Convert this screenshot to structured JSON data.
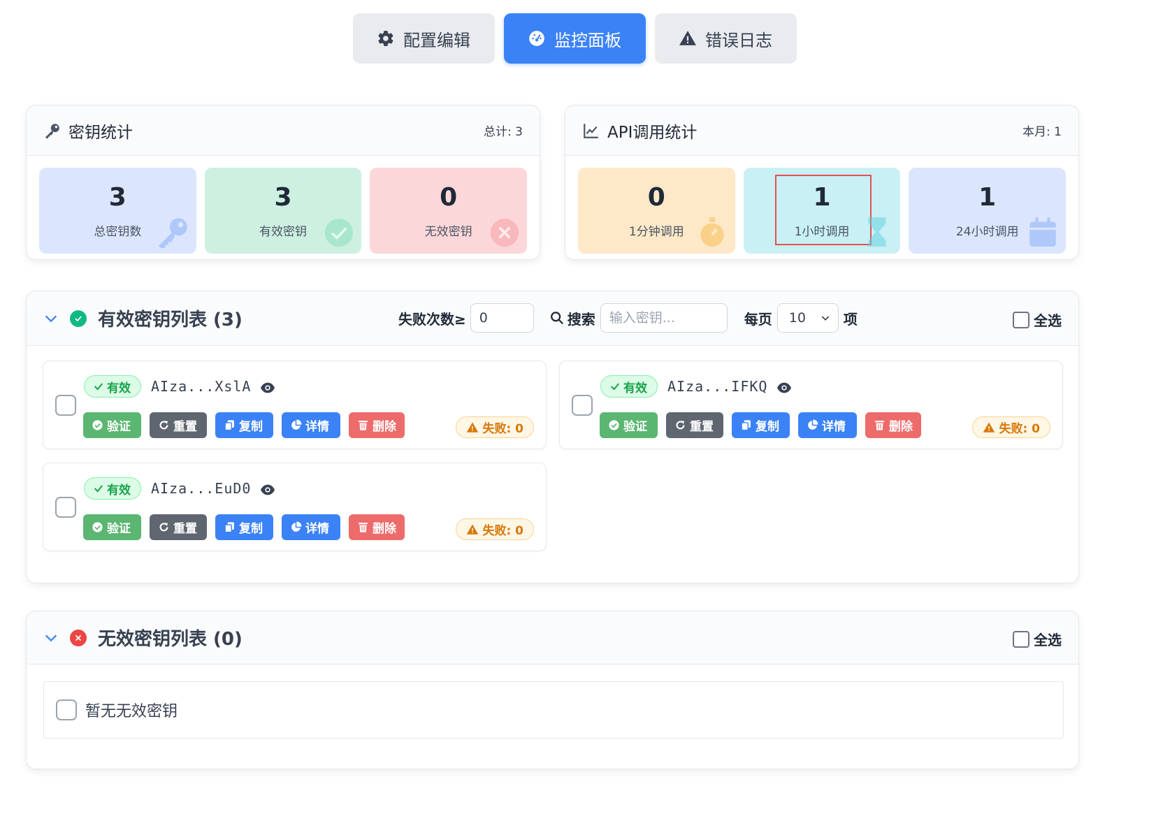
{
  "tabs": [
    {
      "label": "配置编辑",
      "icon": "gear-icon",
      "active": false
    },
    {
      "label": "监控面板",
      "icon": "dashboard-icon",
      "active": true
    },
    {
      "label": "错误日志",
      "icon": "warning-icon",
      "active": false
    }
  ],
  "key_stats": {
    "title": "密钥统计",
    "meta": "总计: 3",
    "cards": [
      {
        "value": "3",
        "label": "总密钥数",
        "icon": "key-icon",
        "color": "#dbe6fe"
      },
      {
        "value": "3",
        "label": "有效密钥",
        "icon": "check-circle-icon",
        "color": "#cdf0e1"
      },
      {
        "value": "0",
        "label": "无效密钥",
        "icon": "x-circle-icon",
        "color": "#fcd7d9"
      }
    ]
  },
  "api_stats": {
    "title": "API调用统计",
    "meta": "本月: 1",
    "cards": [
      {
        "value": "0",
        "label": "1分钟调用",
        "icon": "stopwatch-icon",
        "color": "#fde8c8"
      },
      {
        "value": "1",
        "label": "1小时调用",
        "icon": "hourglass-icon",
        "color": "#c9f0f5"
      },
      {
        "value": "1",
        "label": "24小时调用",
        "icon": "calendar-icon",
        "color": "#dbe6fe"
      }
    ]
  },
  "valid_section": {
    "title": "有效密钥列表 (3)",
    "fail_label": "失败次数≥",
    "fail_value": "0",
    "search_label": "搜索",
    "search_placeholder": "输入密钥...",
    "per_page_label": "每页",
    "per_page_value": "10",
    "per_page_suffix": "项",
    "select_all": "全选",
    "keys": [
      {
        "status": "有效",
        "key": "AIza...XslA",
        "fail": "失败: 0"
      },
      {
        "status": "有效",
        "key": "AIza...IFKQ",
        "fail": "失败: 0"
      },
      {
        "status": "有效",
        "key": "AIza...EuD0",
        "fail": "失败: 0"
      }
    ],
    "buttons": {
      "verify": "验证",
      "reset": "重置",
      "copy": "复制",
      "detail": "详情",
      "delete": "删除"
    }
  },
  "invalid_section": {
    "title": "无效密钥列表 (0)",
    "select_all": "全选",
    "empty_text": "暂无无效密钥"
  },
  "colors": {
    "accent": "#3b82f6",
    "success": "#10b981",
    "danger": "#ef4444",
    "warning": "#d97706"
  }
}
